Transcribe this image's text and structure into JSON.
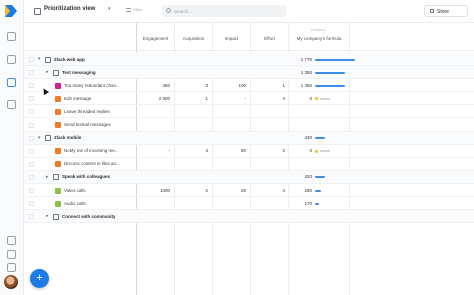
{
  "topbar": {
    "view_title": "Prioritization view",
    "filter_label": "Filter",
    "search_placeholder": "Search...",
    "store_label": "Store"
  },
  "columns": {
    "formula_tag": "FORMULA",
    "engagement": "Engagement",
    "acquisition": "Acquisition",
    "impact": "Impact",
    "effort": "Effort",
    "formula": "My company's formula"
  },
  "colors": {
    "accent": "#3e8ee8",
    "fab": "#1d7be5",
    "magenta": "#d81b8c",
    "orange": "#f07c2a",
    "green": "#8bc34a",
    "yellow": "#e8c21c"
  },
  "rows": [
    {
      "type": "group",
      "level": 0,
      "label": "Zlack web app",
      "score": "1 770",
      "score_fraction": 1.0
    },
    {
      "type": "group",
      "level": 1,
      "label": "Text messaging",
      "score": "1 350",
      "score_fraction": 0.76
    },
    {
      "type": "feature",
      "color": "magenta",
      "label": "Too many redundant chan...",
      "engagement": "450",
      "acquisition": "3",
      "impact": "100",
      "effort": "1",
      "score": "1 350",
      "score_fraction": 0.76
    },
    {
      "type": "feature",
      "color": "orange",
      "label": "Edit message",
      "engagement": "2 000",
      "acquisition": "1",
      "impact": "-",
      "effort": "4",
      "score": "0",
      "score_fraction": 0.0
    },
    {
      "type": "feature",
      "color": "orange",
      "label": "Leave threaded replies",
      "engagement": "",
      "acquisition": "",
      "impact": "",
      "effort": "",
      "score": "",
      "score_fraction": null
    },
    {
      "type": "feature",
      "color": "orange",
      "label": "Send textual messages",
      "engagement": "",
      "acquisition": "",
      "impact": "",
      "effort": "",
      "score": "",
      "score_fraction": null
    },
    {
      "type": "group",
      "level": 0,
      "label": "Zlack mobile",
      "score": "420",
      "score_fraction": 0.24
    },
    {
      "type": "feature",
      "color": "orange",
      "label": "Notify me of incoming me...",
      "engagement": "-",
      "acquisition": "4",
      "impact": "80",
      "effort": "2",
      "score": "0",
      "score_fraction": 0.0
    },
    {
      "type": "feature",
      "color": "orange",
      "label": "Discuss content in files an...",
      "engagement": "",
      "acquisition": "",
      "impact": "",
      "effort": "",
      "score": "",
      "score_fraction": null
    },
    {
      "type": "group",
      "level": 1,
      "label": "Speak with colleagues",
      "score": "420",
      "score_fraction": 0.24
    },
    {
      "type": "feature",
      "color": "green",
      "label": "Video calls",
      "engagement": "1000",
      "acquisition": "2",
      "impact": "25",
      "effort": "4",
      "score": "250",
      "score_fraction": 0.14
    },
    {
      "type": "feature",
      "color": "green",
      "label": "Audio calls",
      "engagement": "",
      "acquisition": "",
      "impact": "",
      "effort": "",
      "score": "170",
      "score_fraction": 0.1
    },
    {
      "type": "group",
      "level": 1,
      "label": "Connect with community",
      "score": "",
      "score_fraction": null
    }
  ]
}
